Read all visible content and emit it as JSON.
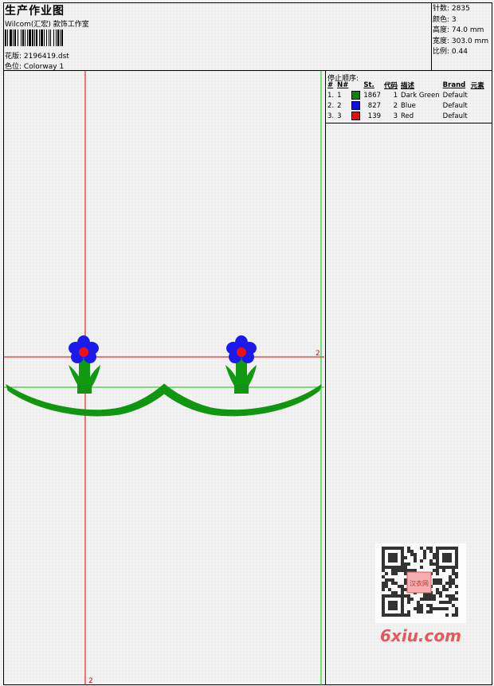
{
  "header": {
    "title": "生产作业图",
    "studio": "Wilcom(汇宏) 款饰工作室",
    "design_file_label": "花版:",
    "design_file": "2196419.dst",
    "colorway_label": "色位:",
    "colorway": "Colorway 1"
  },
  "stats": {
    "stitches_label": "针数:",
    "stitches": "2835",
    "colors_label": "颜色:",
    "colors": "3",
    "height_label": "高度:",
    "height": "74.0 mm",
    "width_label": "宽度:",
    "width": "303.0 mm",
    "scale_label": "比例:",
    "scale": "0.44"
  },
  "stop_sequence": {
    "title": "停止顺序:",
    "headers": [
      "#",
      "N#",
      "St.",
      "代码",
      "描述",
      "Brand",
      "元素"
    ],
    "rows": [
      {
        "index": "1.",
        "needle": "1",
        "color": "#108010",
        "stitches": "1867",
        "code": "1",
        "description": "Dark Green",
        "brand": "Default"
      },
      {
        "index": "2.",
        "needle": "2",
        "color": "#1010e0",
        "stitches": "827",
        "code": "2",
        "description": "Blue",
        "brand": "Default"
      },
      {
        "index": "3.",
        "needle": "3",
        "color": "#e01010",
        "stitches": "139",
        "code": "3",
        "description": "Red",
        "brand": "Default"
      }
    ]
  },
  "markers": {
    "horizontal_label": "2",
    "vertical_label": "2"
  },
  "colors": {
    "green": "#119911",
    "blue": "#1a1aee",
    "red": "#ee1111",
    "guide_red": "#e00000",
    "guide_green": "#00cc00"
  },
  "watermark": {
    "qr_center_text": "汉衣网",
    "logo_text": "6xiu.com"
  }
}
